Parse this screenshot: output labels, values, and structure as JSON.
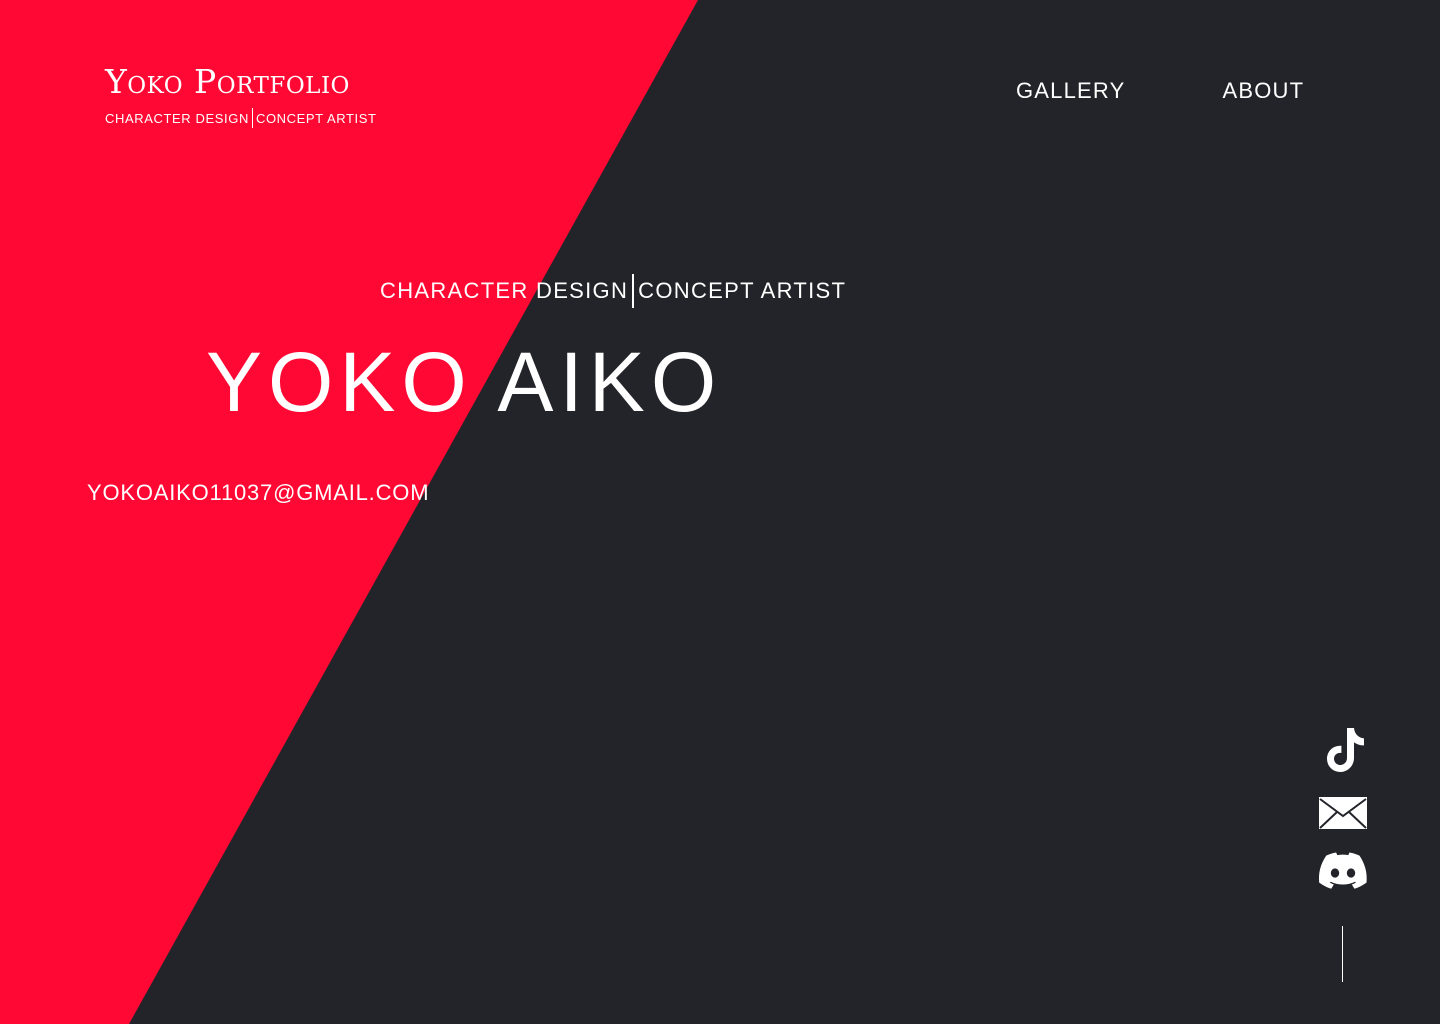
{
  "colors": {
    "background": "#232429",
    "accent": "#ff0833",
    "text": "#ffffff"
  },
  "brand": {
    "title": "Yoko Portfolio",
    "sub_left": "CHARACTER DESIGN",
    "sub_right": "CONCEPT ARTIST"
  },
  "nav": {
    "items": [
      {
        "label": "GALLERY"
      },
      {
        "label": "ABOUT"
      }
    ]
  },
  "hero": {
    "sub_left": "CHARACTER DESIGN",
    "sub_right": "CONCEPT ARTIST",
    "name": "YOKO AIKO",
    "email": "YOKOAIKO11037@GMAIL.COM"
  },
  "social": {
    "icons": [
      "tiktok-icon",
      "mail-icon",
      "discord-icon"
    ]
  }
}
